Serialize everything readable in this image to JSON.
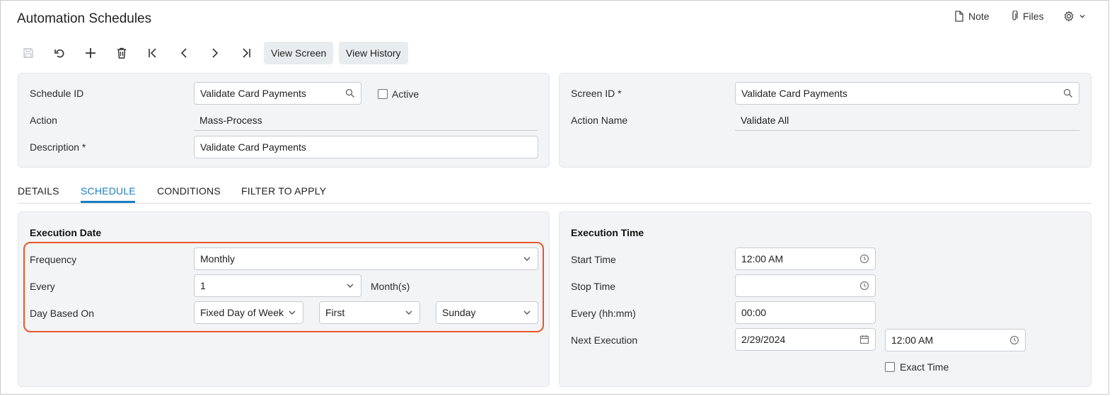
{
  "header": {
    "title": "Automation Schedules",
    "note_label": "Note",
    "files_label": "Files"
  },
  "toolbar": {
    "view_screen_label": "View Screen",
    "view_history_label": "View History",
    "icons": [
      "save-icon",
      "undo-icon",
      "add-icon",
      "delete-icon",
      "first-icon",
      "previous-icon",
      "next-icon",
      "last-icon"
    ]
  },
  "summary_left": {
    "schedule_id_label": "Schedule ID",
    "schedule_id_value": "Validate Card Payments",
    "active_label": "Active",
    "action_label": "Action",
    "action_value": "Mass-Process",
    "description_label": "Description",
    "description_value": "Validate Card Payments"
  },
  "summary_right": {
    "screen_id_label": "Screen ID",
    "screen_id_value": "Validate Card Payments",
    "action_name_label": "Action Name",
    "action_name_value": "Validate All"
  },
  "required_mark": "*",
  "tabs": [
    {
      "label": "DETAILS"
    },
    {
      "label": "SCHEDULE"
    },
    {
      "label": "CONDITIONS"
    },
    {
      "label": "FILTER TO APPLY"
    }
  ],
  "execution_date": {
    "title": "Execution Date",
    "frequency_label": "Frequency",
    "frequency_value": "Monthly",
    "every_label": "Every",
    "every_value": "1",
    "every_unit": "Month(s)",
    "day_based_on_label": "Day Based On",
    "day_based_on_value": "Fixed Day of Week",
    "week_ordinal_value": "First",
    "weekday_value": "Sunday"
  },
  "execution_time": {
    "title": "Execution Time",
    "start_time_label": "Start Time",
    "start_time_value": "12:00 AM",
    "stop_time_label": "Stop Time",
    "stop_time_value": "",
    "every_label": "Every (hh:mm)",
    "every_value": "00:00",
    "next_execution_label": "Next Execution",
    "next_execution_date": "2/29/2024",
    "next_execution_time": "12:00 AM",
    "exact_time_label": "Exact Time"
  },
  "colors": {
    "accent": "#1a7fc1",
    "highlight": "#e8562a",
    "panel": "#f3f4f6"
  }
}
